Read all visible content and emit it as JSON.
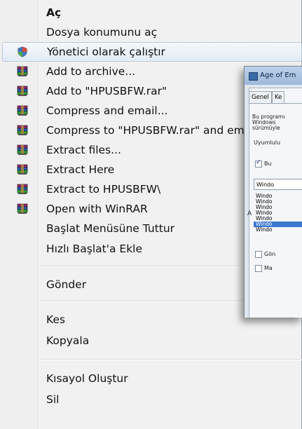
{
  "menu": {
    "items": [
      {
        "label": "Aç",
        "bold": true
      },
      {
        "label": "Dosya konumunu aç"
      },
      {
        "label": "Yönetici olarak çalıştır",
        "icon": "uac-shield-icon",
        "highlighted": true
      },
      {
        "label": "Add to archive...",
        "icon": "winrar-icon"
      },
      {
        "label": "Add to \"HPUSBFW.rar\"",
        "icon": "winrar-icon"
      },
      {
        "label": "Compress and email...",
        "icon": "winrar-icon"
      },
      {
        "label": "Compress to \"HPUSBFW.rar\" and email",
        "icon": "winrar-icon"
      },
      {
        "label": "Extract files...",
        "icon": "winrar-icon"
      },
      {
        "label": "Extract Here",
        "icon": "winrar-icon"
      },
      {
        "label": "Extract to HPUSBFW\\",
        "icon": "winrar-icon"
      },
      {
        "label": "Open with WinRAR",
        "icon": "winrar-icon"
      },
      {
        "label": "Başlat Menüsüne Tuttur"
      },
      {
        "label": "Hızlı Başlat'a Ekle"
      },
      {
        "label": "Gönder"
      },
      {
        "label": "Kes"
      },
      {
        "label": "Kopyala"
      },
      {
        "label": "Kısayol Oluştur"
      },
      {
        "label": "Sil"
      }
    ]
  },
  "window": {
    "title": "Age of Em",
    "tabs": [
      "Genel",
      "Ke"
    ],
    "desc": [
      "Bu programı",
      "Windows",
      "sürümüyle"
    ],
    "group_label": "Uyumlulu",
    "checkbox_label": "Bu",
    "combo_value": "Windo",
    "list_items": [
      "Windo",
      "Windo",
      "Windo",
      "Windo",
      "Windo",
      "Windo",
      "Windo"
    ],
    "side_letter": "A",
    "chk2_label": "Gön",
    "chk3_label": "Ma"
  },
  "colors": {
    "menu_bg": "#f1f1f1",
    "highlight_border": "#b9c9dd",
    "list_selection": "#3d78d0"
  }
}
